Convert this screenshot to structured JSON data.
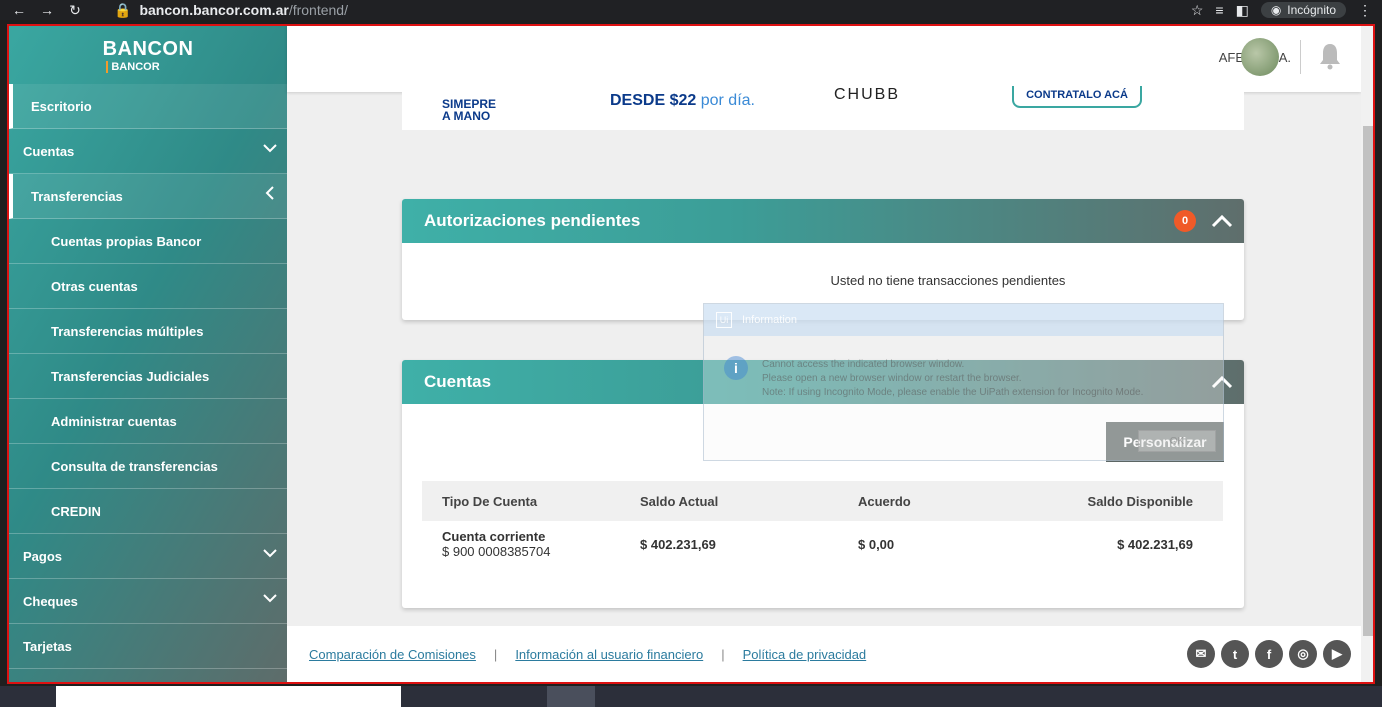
{
  "browser": {
    "url_host": "bancon.bancor.com.ar",
    "url_path": "/frontend/",
    "incognito_label": "Incógnito"
  },
  "logo": {
    "brand": "BANCON",
    "sub": "BANCOR"
  },
  "sidebar": {
    "items": [
      {
        "label": "Escritorio"
      },
      {
        "label": "Cuentas"
      },
      {
        "label": "Transferencias"
      },
      {
        "label": "Cuentas propias Bancor"
      },
      {
        "label": "Otras cuentas"
      },
      {
        "label": "Transferencias múltiples"
      },
      {
        "label": "Transferencias Judiciales"
      },
      {
        "label": "Administrar cuentas"
      },
      {
        "label": "Consulta de transferencias"
      },
      {
        "label": "CREDIN"
      },
      {
        "label": "Pagos"
      },
      {
        "label": "Cheques"
      },
      {
        "label": "Tarjetas"
      }
    ]
  },
  "header": {
    "company": "AFEMA S.A."
  },
  "banner": {
    "text1a": "SIMEPRE",
    "text1b": "A MANO",
    "text2": "DESDE $22",
    "text2b": "por día.",
    "text3": "CHUBB",
    "text4": "CONTRATALO ACÁ"
  },
  "pending": {
    "title": "Autorizaciones pendientes",
    "count": "0",
    "message": "Usted no tiene transacciones pendientes"
  },
  "accounts": {
    "title": "Cuentas",
    "customize_label": "Personalizar",
    "columns": [
      "Tipo De Cuenta",
      "Saldo Actual",
      "Acuerdo",
      "Saldo Disponible"
    ],
    "rows": [
      {
        "type": "Cuenta corriente",
        "number": "$ 900 0008385704",
        "saldo": "$ 402.231,69",
        "acuerdo": "$ 0,00",
        "disponible": "$ 402.231,69"
      }
    ]
  },
  "footer": {
    "links": [
      "Comparación de Comisiones",
      "Información al usuario financiero",
      "Política de privacidad"
    ],
    "separator": "|"
  },
  "dialog": {
    "title": "Information",
    "line1": "Cannot access the indicated browser window.",
    "line2": "Please open a new browser window or restart the browser.",
    "line3": "Note: If using Incognito Mode, please enable the UiPath extension for Incognito Mode.",
    "ok_label": "OK"
  },
  "colors": {
    "accent": "#3aa7a1",
    "badge": "#f05a28",
    "link": "#2b7b9e"
  }
}
